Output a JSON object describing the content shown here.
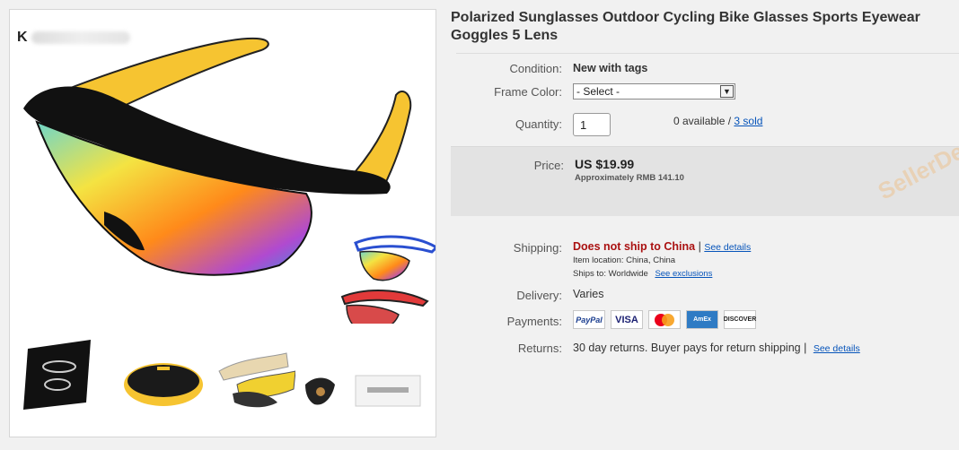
{
  "title": "Polarized Sunglasses Outdoor Cycling Bike Glasses Sports Eyewear Goggles 5 Lens",
  "image": {
    "logo_mark": "K",
    "thumbnails": [
      "case-bag",
      "hard-case",
      "spare-lenses",
      "nose-pads",
      "cleaning-cloth"
    ]
  },
  "condition": {
    "label": "Condition:",
    "value": "New with tags"
  },
  "frame_color": {
    "label": "Frame Color:",
    "selected": "- Select -"
  },
  "quantity": {
    "label": "Quantity:",
    "value": "1",
    "available": "0 available / ",
    "sold": "3 sold"
  },
  "price": {
    "label": "Price:",
    "value": "US $19.99",
    "approx": "Approximately RMB 141.10"
  },
  "watermark": "SellerDefense",
  "shipping": {
    "label": "Shipping:",
    "status": "Does not ship to China",
    "sep": " | ",
    "details_link": "See details",
    "item_location_label": "Item location:",
    "item_location": "China, China",
    "ships_to_label": "Ships to:",
    "ships_to": "Worldwide",
    "exclusions_link": "See exclusions"
  },
  "delivery": {
    "label": "Delivery:",
    "value": "Varies"
  },
  "payments": {
    "label": "Payments:",
    "methods": [
      "PayPal",
      "VISA",
      "MasterCard",
      "AmEx",
      "DISCOVER"
    ]
  },
  "returns": {
    "label": "Returns:",
    "value": "30 day returns. Buyer pays for return shipping |",
    "details_link": "See details"
  },
  "colors": {
    "accent_link": "#0654ba",
    "status_red": "#aa1111",
    "lens_orange": "#ff9a1a",
    "arm_yellow": "#f6c431"
  }
}
